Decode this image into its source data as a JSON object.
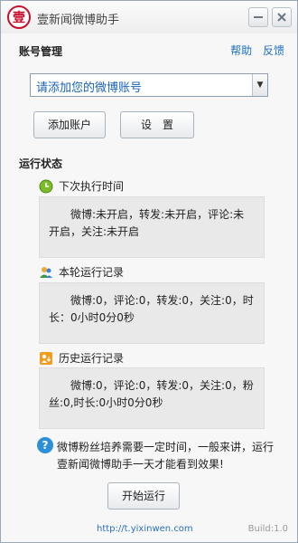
{
  "window": {
    "title": "壹新闻微博助手"
  },
  "account": {
    "heading": "账号管理",
    "help": "帮助",
    "feedback": "反馈",
    "select_value": "请添加您的微博账号",
    "add_button": "添加账户",
    "settings_button": "设　置"
  },
  "status": {
    "heading": "运行状态",
    "next_run": {
      "label": "下次执行时间",
      "text": "微博:未开启，转发:未开启，评论:未开启，关注:未开启"
    },
    "current": {
      "label": "本轮运行记录",
      "text": "微博:0，评论:0，转发:0，关注:0，时长：0小时0分0秒"
    },
    "history": {
      "label": "历史运行记录",
      "text": "微博:0，评论:0，转发:0，关注:0，粉丝:0,时长:0小时0分0秒"
    }
  },
  "tip": {
    "text": "微博粉丝培养需要一定时间，一般来讲，运行壹新闻微博助手一天才能看到效果!"
  },
  "start_button": "开始运行",
  "footer": {
    "url": "http://t.yixinwen.com",
    "build": "Build:1.0"
  },
  "colors": {
    "link": "#1a6fc0",
    "accent": "#c8102e"
  },
  "icons": [
    "app-logo-icon",
    "minimize-icon",
    "close-icon",
    "dropdown-arrow-icon",
    "clock-icon",
    "users-icon",
    "history-icon",
    "help-icon"
  ]
}
